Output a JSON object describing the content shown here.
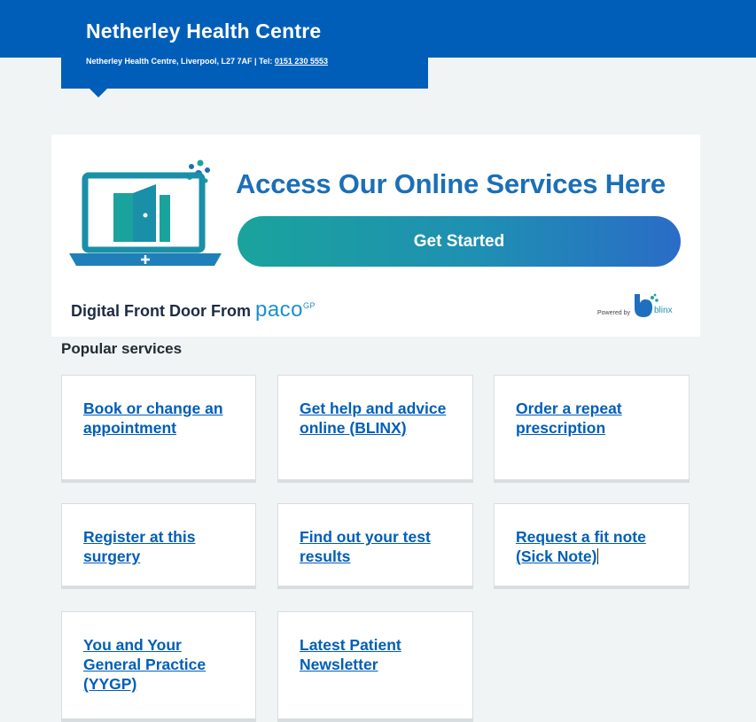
{
  "header": {
    "title": "Netherley Health Centre",
    "address": "Netherley Health Centre, Liverpool, L27 7AF | Tel: ",
    "phone": "0151 230 5553"
  },
  "banner": {
    "heading": "Access Our Online Services Here",
    "button_label": "Get Started",
    "tagline": "Digital Front Door From ",
    "paco_logo_text": "paco",
    "paco_sup": "GP",
    "powered_by": "Powered by",
    "blinx_text": "blinx"
  },
  "popular": {
    "heading": "Popular services",
    "services": [
      "Book or change an appointment",
      "Get help and advice online (BLINX)",
      "Order a repeat prescription",
      "Register at this surgery",
      "Find out your test results",
      "Request a fit note (Sick Note)",
      "You and Your General Practice (YYGP)",
      "Latest Patient Newsletter"
    ]
  },
  "colors": {
    "brand_blue": "#005eb8",
    "page_bg": "#f0f4f5",
    "link": "#005eb8",
    "gradient_start": "#1aa39c",
    "gradient_end": "#2a6cc6"
  }
}
